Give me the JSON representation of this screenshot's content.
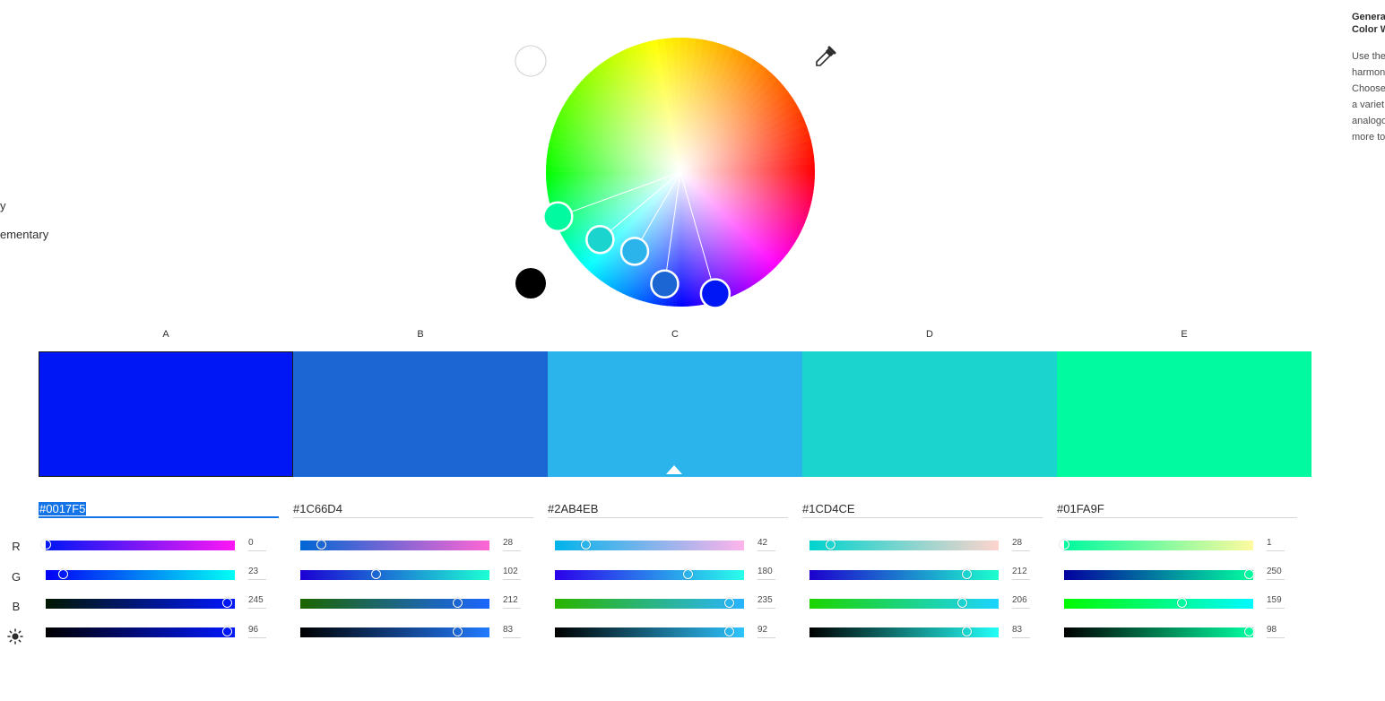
{
  "left_menu": {
    "items": [
      "y",
      "ementary"
    ]
  },
  "info_panel": {
    "title_lines": [
      "Genera",
      "Color W"
    ],
    "body_lines": [
      "Use the",
      "harmon",
      "Choose",
      "a variet",
      "analogo",
      "more to"
    ]
  },
  "wheel": {
    "picker_angles_deg": [
      200,
      220,
      240,
      262,
      286
    ],
    "picker_radius_fraction": [
      0.97,
      0.78,
      0.68,
      0.84,
      0.94
    ],
    "picker_colors": [
      "#01FA9F",
      "#1CD4CE",
      "#2AB4EB",
      "#1C66D4",
      "#0017F5"
    ],
    "brightness_light_color": "#ffffff",
    "brightness_dark_color": "#000000"
  },
  "eyedropper": {
    "icon": "eyedropper-icon"
  },
  "swatches": {
    "labels": [
      "A",
      "B",
      "C",
      "D",
      "E"
    ],
    "colors": [
      "#0017F5",
      "#1C66D4",
      "#2AB4EB",
      "#1CD4CE",
      "#01FA9F"
    ],
    "selected_index": 0,
    "base_index": 2
  },
  "channel_labels": [
    "R",
    "G",
    "B"
  ],
  "brightness_icon": "sun-icon",
  "colors": [
    {
      "hex": "#0017F5",
      "r": 0,
      "g": 23,
      "b": 245,
      "brightness": 96
    },
    {
      "hex": "#1C66D4",
      "r": 28,
      "g": 102,
      "b": 212,
      "brightness": 83
    },
    {
      "hex": "#2AB4EB",
      "r": 42,
      "g": 180,
      "b": 235,
      "brightness": 92
    },
    {
      "hex": "#1CD4CE",
      "r": 28,
      "g": 212,
      "b": 206,
      "brightness": 83
    },
    {
      "hex": "#01FA9F",
      "r": 1,
      "g": 250,
      "b": 159,
      "brightness": 98
    }
  ]
}
